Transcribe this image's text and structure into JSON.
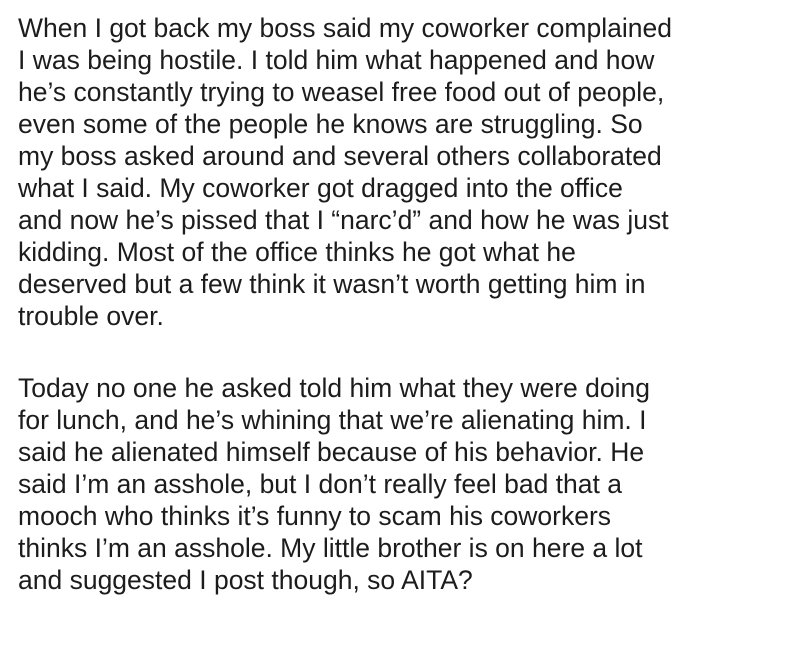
{
  "paragraphs": [
    {
      "lines": [
        "When I got back my boss said my coworker complained",
        "I was being hostile. I told him what happened and how",
        "he’s constantly trying to weasel free food out of people,",
        "even some of the people he knows are struggling. So",
        "my boss asked around and several others collaborated",
        "what I said. My coworker got dragged into the office",
        "and now he’s pissed that I “narc’d” and how he was just",
        "kidding. Most of the office thinks he got what he",
        "deserved but a few think it wasn’t worth getting him in",
        "trouble over."
      ]
    },
    {
      "lines": [
        "Today no one he asked told him what they were doing",
        "for lunch, and he’s whining that we’re alienating him. I",
        "said he alienated himself because of his behavior. He",
        "said I’m an asshole, but I don’t really feel bad that a",
        "mooch who thinks it’s funny to scam his coworkers",
        "thinks I’m an asshole. My little brother is on here a lot",
        "and suggested I post though, so AITA?"
      ]
    }
  ]
}
